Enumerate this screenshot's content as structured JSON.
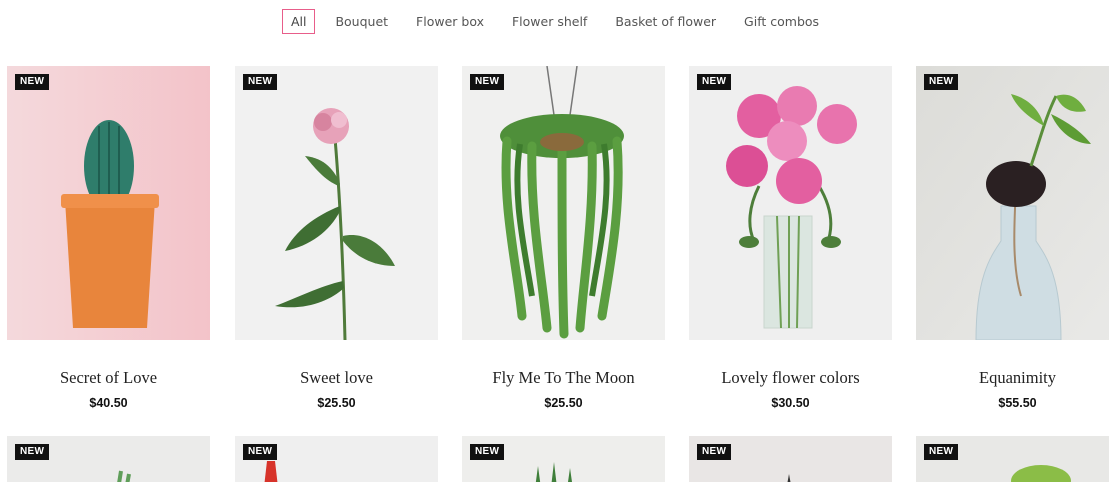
{
  "filters": [
    "All",
    "Bouquet",
    "Flower box",
    "Flower shelf",
    "Basket of flower",
    "Gift combos"
  ],
  "active_filter": "All",
  "products": [
    {
      "badge": "NEW",
      "name": "Secret of Love",
      "price": "$40.50"
    },
    {
      "badge": "NEW",
      "name": "Sweet love",
      "price": "$25.50"
    },
    {
      "badge": "NEW",
      "name": "Fly Me To The Moon",
      "price": "$25.50"
    },
    {
      "badge": "NEW",
      "name": "Lovely flower colors",
      "price": "$30.50"
    },
    {
      "badge": "NEW",
      "name": "Equanimity",
      "price": "$55.50"
    }
  ],
  "next_row_badges": [
    "NEW",
    "NEW",
    "NEW",
    "NEW",
    "NEW"
  ],
  "colors": {
    "accent": "#e85d8a",
    "badge_bg": "#111111"
  }
}
